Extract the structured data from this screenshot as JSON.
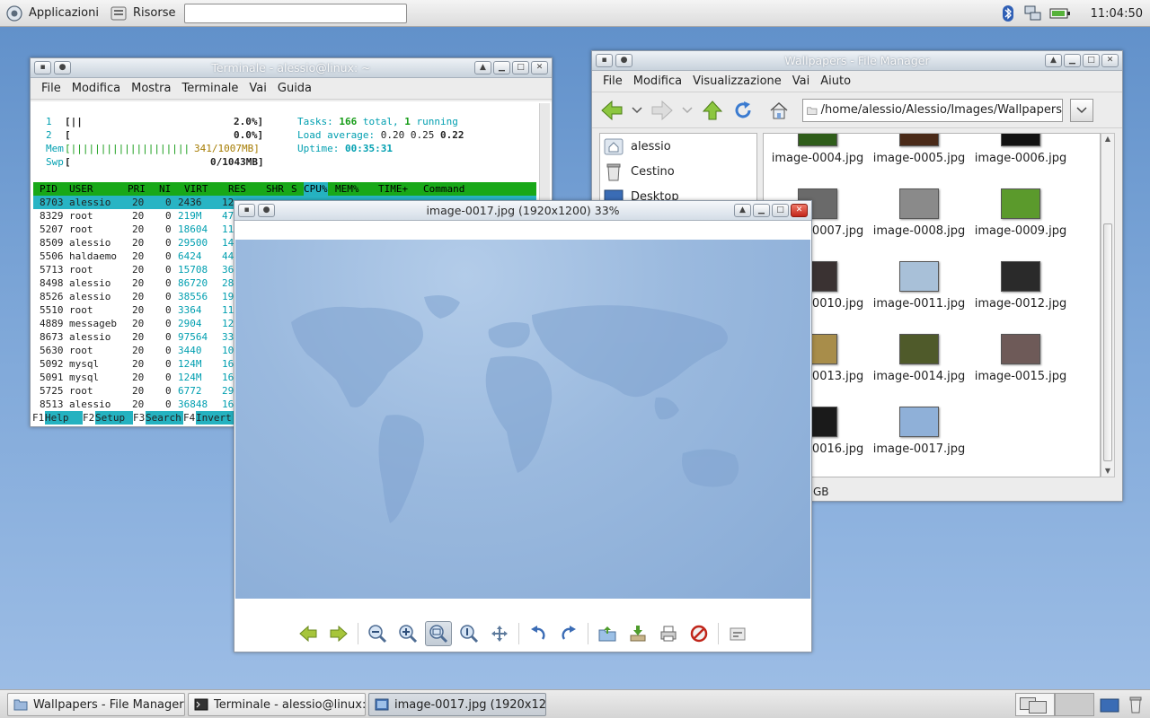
{
  "top_panel": {
    "apps_label": "Applicazioni",
    "places_label": "Risorse",
    "clock": "11:04:50"
  },
  "terminal": {
    "title": "Terminale - alessio@linux: ~",
    "menu": [
      "File",
      "Modifica",
      "Mostra",
      "Terminale",
      "Vai",
      "Guida"
    ],
    "htop": {
      "cpu1_label": "1",
      "cpu1_bar": "[||",
      "cpu1_pct": "2.0%]",
      "cpu2_label": "2",
      "cpu2_bar": "[",
      "cpu2_pct": "0.0%]",
      "mem_label": "Mem",
      "mem_bar": "[||||||||||||||||||||",
      "mem_value": "341/1007MB]",
      "swp_label": "Swp",
      "swp_bar": "[",
      "swp_value": "0/1043MB]",
      "tasks_label": "Tasks:",
      "tasks_total": "166",
      "tasks_total_label": "total,",
      "tasks_running": "1",
      "tasks_running_label": "running",
      "load_label": "Load average:",
      "load_1": "0.20",
      "load_5": "0.25",
      "load_15": "0.22",
      "uptime_label": "Uptime:",
      "uptime": "00:35:31",
      "headers": [
        "PID",
        "USER",
        "PRI",
        "NI",
        "VIRT",
        "RES",
        "SHR",
        "S",
        "CPU%",
        "MEM%",
        "TIME+",
        "Command"
      ],
      "rows": [
        {
          "pid": "8703",
          "user": "alessio",
          "pri": "20",
          "ni": "0",
          "virt": "2436",
          "res": "12"
        },
        {
          "pid": "8329",
          "user": "root",
          "pri": "20",
          "ni": "0",
          "virt": "219M",
          "res": "47"
        },
        {
          "pid": "5207",
          "user": "root",
          "pri": "20",
          "ni": "0",
          "virt": "18604",
          "res": "11"
        },
        {
          "pid": "8509",
          "user": "alessio",
          "pri": "20",
          "ni": "0",
          "virt": "29500",
          "res": "14"
        },
        {
          "pid": "5506",
          "user": "haldaemo",
          "pri": "20",
          "ni": "0",
          "virt": "6424",
          "res": "44"
        },
        {
          "pid": "5713",
          "user": "root",
          "pri": "20",
          "ni": "0",
          "virt": "15708",
          "res": "36"
        },
        {
          "pid": "8498",
          "user": "alessio",
          "pri": "20",
          "ni": "0",
          "virt": "86720",
          "res": "28"
        },
        {
          "pid": "8526",
          "user": "alessio",
          "pri": "20",
          "ni": "0",
          "virt": "38556",
          "res": "19"
        },
        {
          "pid": "5510",
          "user": "root",
          "pri": "20",
          "ni": "0",
          "virt": "3364",
          "res": "11"
        },
        {
          "pid": "4889",
          "user": "messageb",
          "pri": "20",
          "ni": "0",
          "virt": "2904",
          "res": "12"
        },
        {
          "pid": "8673",
          "user": "alessio",
          "pri": "20",
          "ni": "0",
          "virt": "97564",
          "res": "33"
        },
        {
          "pid": "5630",
          "user": "root",
          "pri": "20",
          "ni": "0",
          "virt": "3440",
          "res": "10"
        },
        {
          "pid": "5092",
          "user": "mysql",
          "pri": "20",
          "ni": "0",
          "virt": "124M",
          "res": "16"
        },
        {
          "pid": "5091",
          "user": "mysql",
          "pri": "20",
          "ni": "0",
          "virt": "124M",
          "res": "16"
        },
        {
          "pid": "5725",
          "user": "root",
          "pri": "20",
          "ni": "0",
          "virt": "6772",
          "res": "29"
        },
        {
          "pid": "8513",
          "user": "alessio",
          "pri": "20",
          "ni": "0",
          "virt": "36848",
          "res": "16"
        }
      ],
      "fkeys": [
        {
          "key": "F1",
          "label": "Help"
        },
        {
          "key": "F2",
          "label": "Setup"
        },
        {
          "key": "F3",
          "label": "Search"
        },
        {
          "key": "F4",
          "label": "Invert"
        }
      ]
    }
  },
  "file_manager": {
    "title": "Wallpapers - File Manager",
    "menu": [
      "File",
      "Modifica",
      "Visualizzazione",
      "Vai",
      "Aiuto"
    ],
    "path": "/home/alessio/Alessio/Images/Wallpapers",
    "sidebar": [
      "alessio",
      "Cestino",
      "Desktop"
    ],
    "files": [
      {
        "name": "image-0004.jpg",
        "color": "#2f5d1a"
      },
      {
        "name": "image-0005.jpg",
        "color": "#4a2a18"
      },
      {
        "name": "image-0006.jpg",
        "color": "#111111"
      },
      {
        "name": "image-0007.jpg",
        "color": "#6a6a6a"
      },
      {
        "name": "image-0008.jpg",
        "color": "#8a8a8a"
      },
      {
        "name": "image-0009.jpg",
        "color": "#5b9a2c"
      },
      {
        "name": "image-0010.jpg",
        "color": "#3a3232"
      },
      {
        "name": "image-0011.jpg",
        "color": "#a8c0d8"
      },
      {
        "name": "image-0012.jpg",
        "color": "#2a2a2a"
      },
      {
        "name": "image-0013.jpg",
        "color": "#a88d4a"
      },
      {
        "name": "image-0014.jpg",
        "color": "#4f5a2a"
      },
      {
        "name": "image-0015.jpg",
        "color": "#6e5a58"
      },
      {
        "name": "image-0016.jpg",
        "color": "#1a1a1a"
      },
      {
        "name": "image-0017.jpg",
        "color": "#8fb0d8"
      }
    ],
    "status": "GB"
  },
  "image_viewer": {
    "title": "image-0017.jpg (1920x1200) 33%"
  },
  "taskbar": {
    "tasks": [
      "Wallpapers - File Manager",
      "Terminale - alessio@linux: ~",
      "image-0017.jpg (1920x12..."
    ]
  },
  "colors": {
    "desktop": "#7ea7d8",
    "htop_header": "#18a818",
    "htop_selected": "#28b4c4",
    "close_button": "#c2261a"
  }
}
